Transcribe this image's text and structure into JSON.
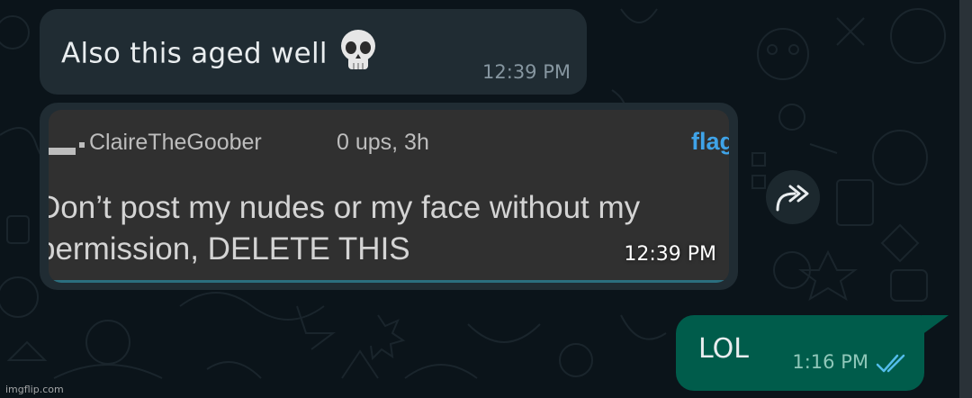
{
  "messages": [
    {
      "direction": "incoming",
      "text": "Also this aged well",
      "emoji": "skull",
      "time": "12:39 PM"
    },
    {
      "direction": "incoming",
      "type": "image",
      "time": "12:39 PM",
      "screenshot": {
        "username": "ClaireTheGoober",
        "meta": "0 ups, 3h",
        "flag": "flag",
        "comment_lines": [
          "Don’t post my nudes or my face without my",
          "permission, DELETE THIS"
        ]
      }
    },
    {
      "direction": "outgoing",
      "text": "LOL",
      "time": "1:16 PM",
      "status": "read"
    }
  ],
  "forward_icon": "forward-icon",
  "watermark": "imgflip.com",
  "colors": {
    "background": "#0b141a",
    "incoming_bubble": "#202c33",
    "outgoing_bubble": "#005c4b",
    "read_ticks": "#53bdeb",
    "flag_link": "#3fa3e8"
  }
}
